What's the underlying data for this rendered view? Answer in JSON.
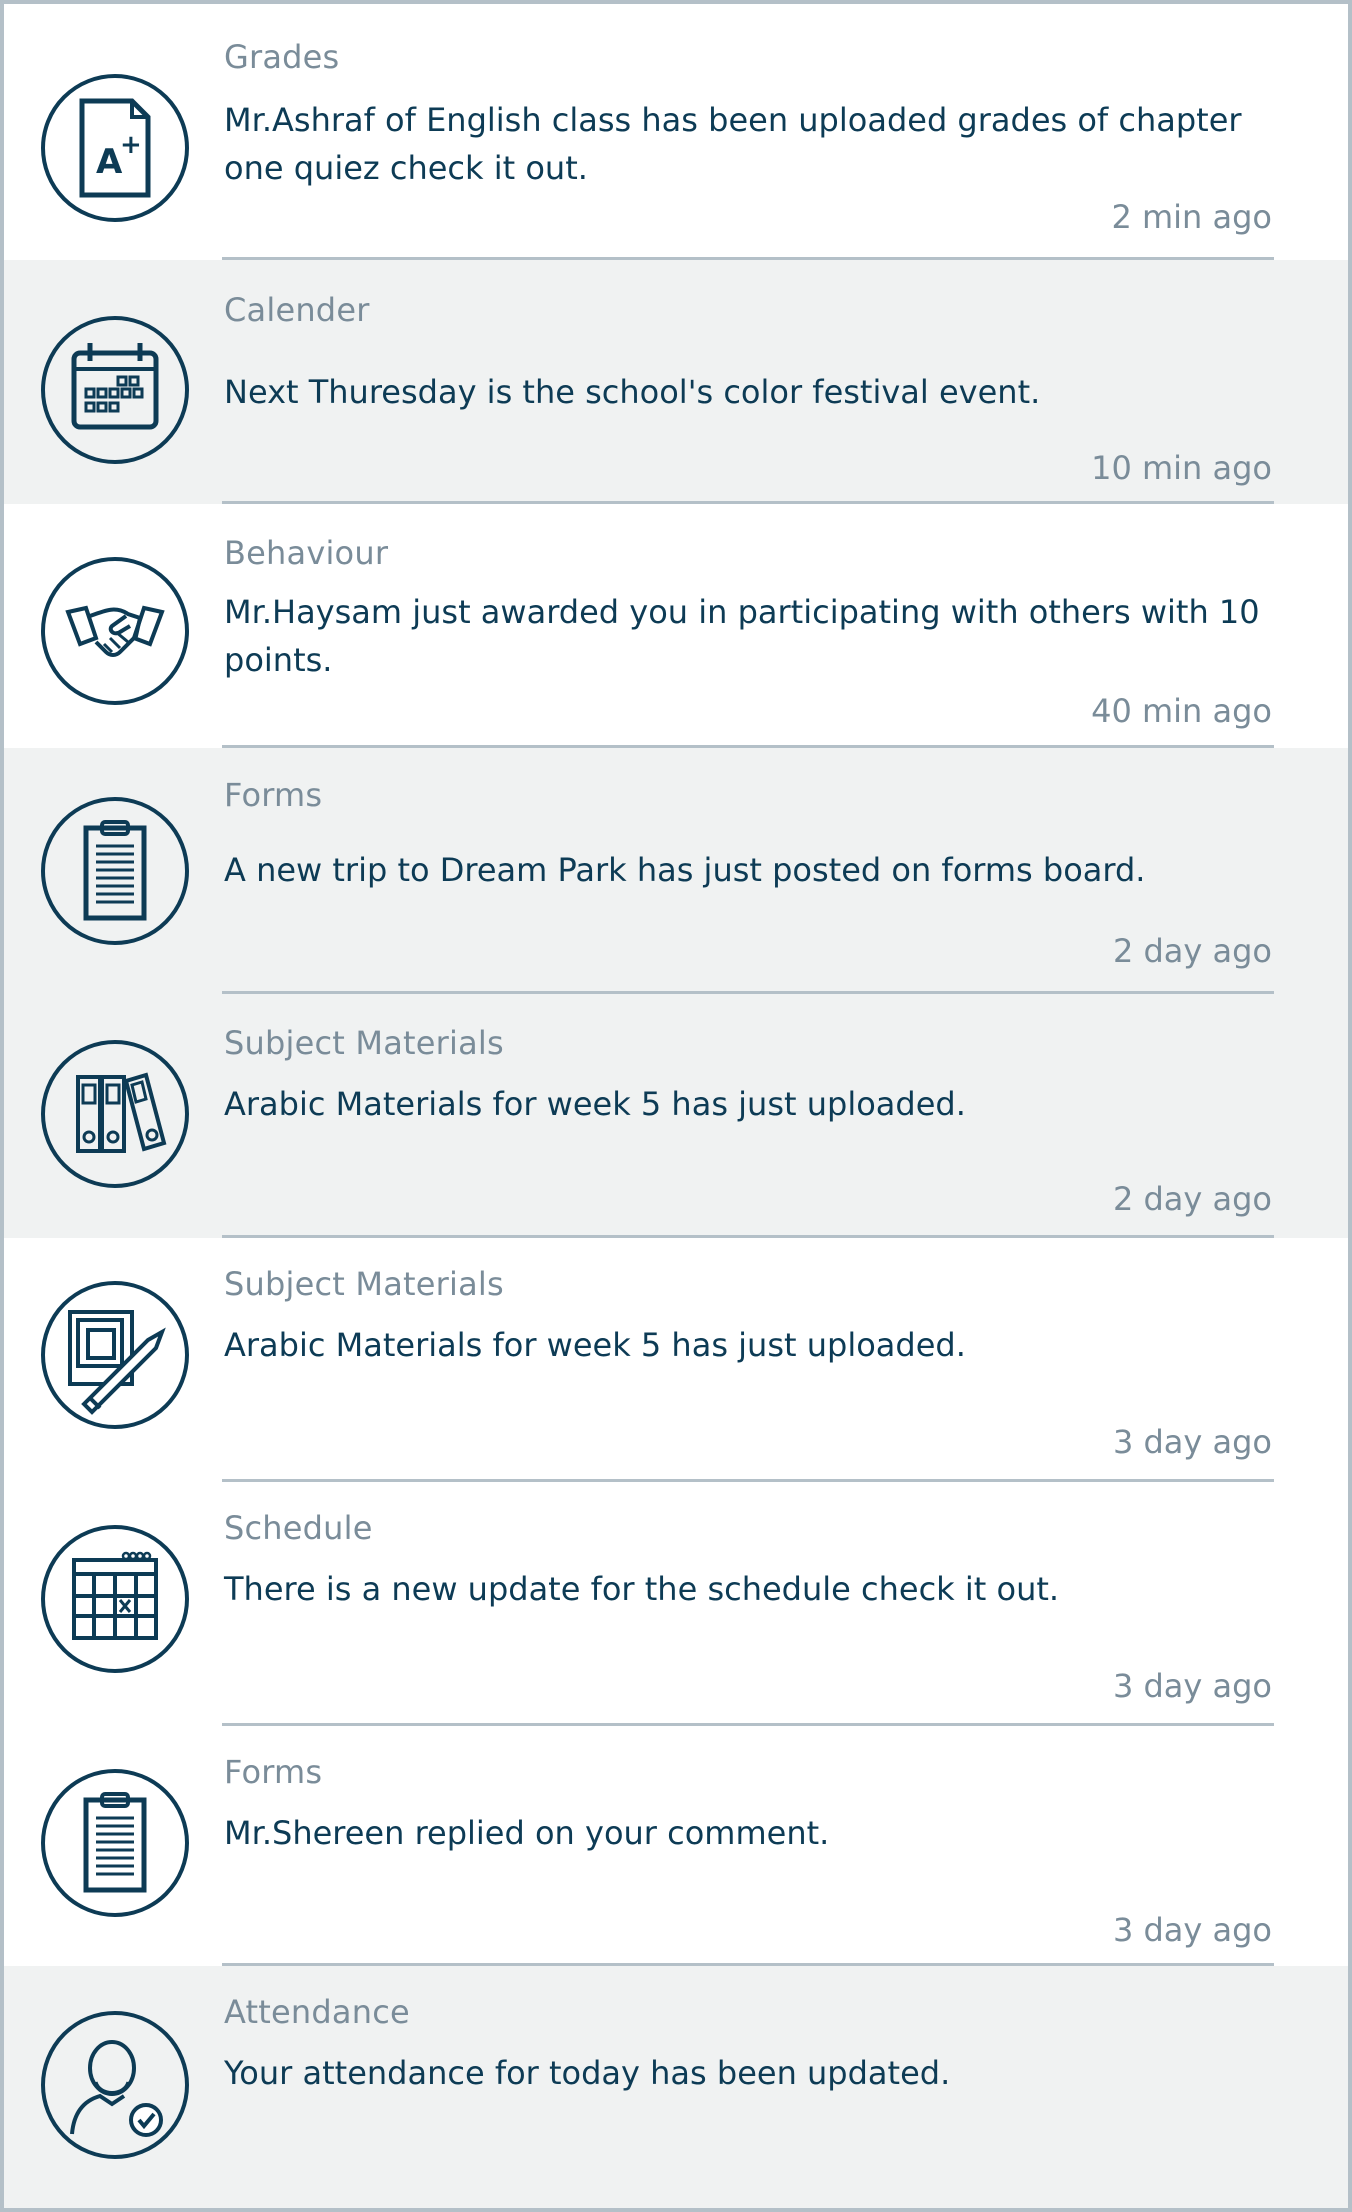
{
  "theme": {
    "accent": "#0d3b55",
    "muted": "#7a8c99",
    "divider": "#b4c0c8",
    "grey_row": "#f0f2f2"
  },
  "notifications": [
    {
      "category": "Grades",
      "message": "Mr.Ashraf of English class has been uploaded grades of chapter one quiez check it out.",
      "time": "2 min ago",
      "icon": "grade-a-plus-icon"
    },
    {
      "category": "Calender",
      "message": "Next Thuresday is the school's color festival event.",
      "time": "10 min ago",
      "icon": "calendar-icon"
    },
    {
      "category": "Behaviour",
      "message": "Mr.Haysam just awarded you in participating with others with 10 points.",
      "time": "40 min ago",
      "icon": "handshake-icon"
    },
    {
      "category": "Forms",
      "message": "A new trip to Dream Park has just posted on forms board.",
      "time": "2 day ago",
      "icon": "clipboard-icon"
    },
    {
      "category": "Subject Materials",
      "message": "Arabic Materials for week 5 has just uploaded.",
      "time": "2 day ago",
      "icon": "binders-icon"
    },
    {
      "category": "Subject Materials",
      "message": "Arabic Materials for week 5 has just uploaded.",
      "time": "3 day ago",
      "icon": "books-pencil-icon"
    },
    {
      "category": "Schedule",
      "message": "There is a new update for the schedule check it out.",
      "time": "3 day ago",
      "icon": "schedule-icon"
    },
    {
      "category": "Forms",
      "message": "Mr.Shereen replied on your comment.",
      "time": "3 day ago",
      "icon": "clipboard-icon"
    },
    {
      "category": "Attendance",
      "message": "Your attendance for today has been updated.",
      "time": "",
      "icon": "user-check-icon"
    }
  ]
}
